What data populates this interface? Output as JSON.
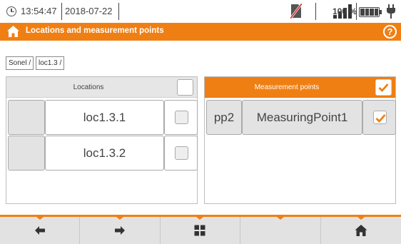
{
  "status": {
    "time": "13:54:47",
    "date": "2018-07-22",
    "battery": "100 %",
    "icons": [
      "clock-icon",
      "no-memory-card-icon",
      "signal-strength-icon",
      "battery-icon",
      "power-plug-icon"
    ]
  },
  "header": {
    "title": "Locations and measurement points",
    "icons": [
      "home-icon",
      "help-icon"
    ],
    "help_symbol": "?"
  },
  "breadcrumb": [
    "Sonel /",
    "loc1.3 /"
  ],
  "locations_panel": {
    "title": "Locations",
    "select_all_checked": false,
    "items": [
      {
        "label": "loc1.3.1",
        "checked": false
      },
      {
        "label": "loc1.3.2",
        "checked": false
      }
    ]
  },
  "points_panel": {
    "title": "Measurement points",
    "select_all_checked": true,
    "items": [
      {
        "id": "pp2",
        "label": "MeasuringPoint1",
        "checked": true
      }
    ]
  },
  "toolbar": {
    "buttons": [
      "arrow-left-icon",
      "arrow-right-icon",
      "grid-menu-icon",
      "",
      "home-icon"
    ]
  },
  "colors": {
    "accent": "#f07f13",
    "toolbar_bg": "#e2e2e2",
    "panel_header": "#e6e6e6"
  }
}
